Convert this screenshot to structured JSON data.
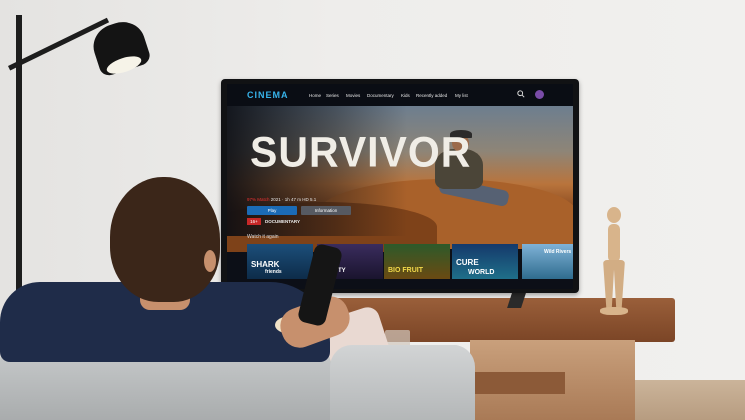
{
  "tv": {
    "logo": "CINEMA",
    "nav": [
      "Home",
      "Series",
      "Movies",
      "Documentary",
      "Kids",
      "Recently added",
      "My list"
    ],
    "hero_title": "SURVIVOR",
    "meta_new": "97% Match",
    "meta_rest": "2021 · 1h 47 m  HD  5.1",
    "play_label": "Play",
    "info_label": "Information",
    "rating": "16+",
    "genre": "DOCUMENTARY",
    "row_title": "Watch it again",
    "thumbnails": [
      {
        "line1": "SHARK",
        "line2": "friends"
      },
      {
        "line1": "BEAUTY",
        "line2": ""
      },
      {
        "line1": "BIO FRUIT",
        "line2": ""
      },
      {
        "line1": "CURE",
        "line2": "WORLD"
      },
      {
        "line1": "Wild Rivers",
        "line2": ""
      }
    ]
  },
  "colors": {
    "brand": "#37b3ea",
    "play_button": "#1b6bb6",
    "rating_badge": "#c62828"
  }
}
